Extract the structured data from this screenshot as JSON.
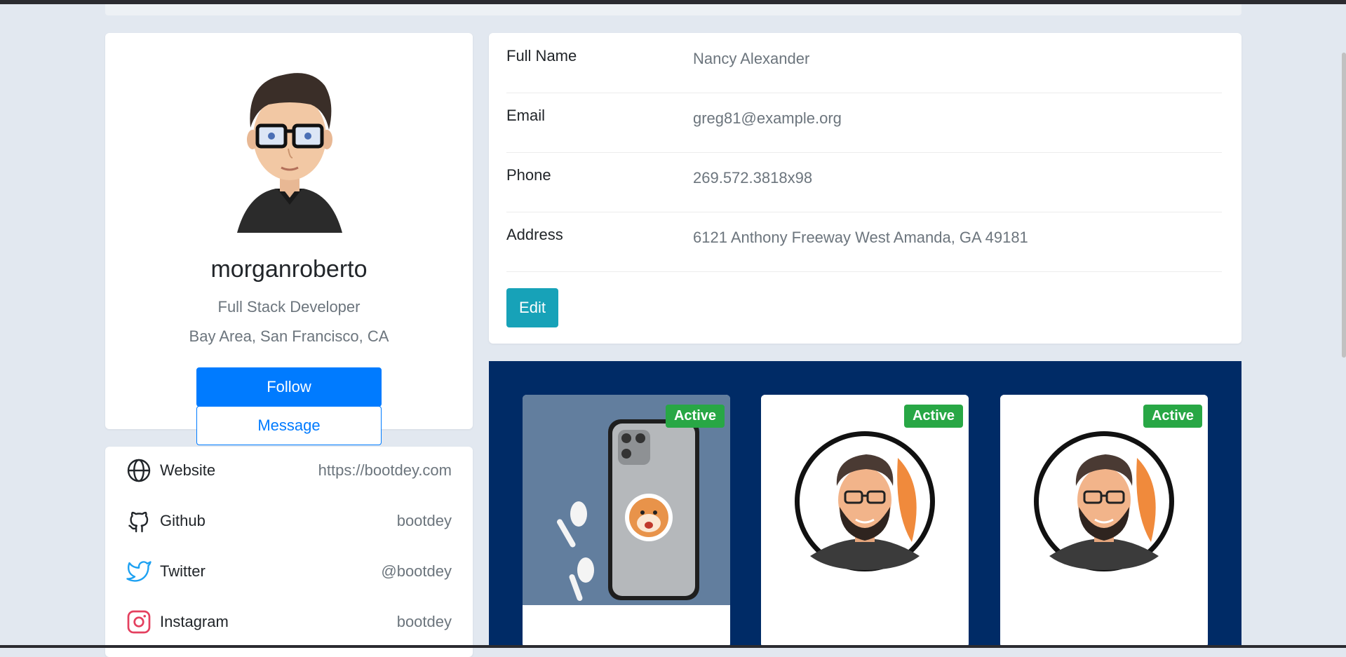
{
  "profile": {
    "username": "morganroberto",
    "role": "Full Stack Developer",
    "location": "Bay Area, San Francisco, CA",
    "follow_label": "Follow",
    "message_label": "Message"
  },
  "social": [
    {
      "icon": "globe-icon",
      "label": "Website",
      "value": "https://bootdey.com"
    },
    {
      "icon": "github-icon",
      "label": "Github",
      "value": "bootdey"
    },
    {
      "icon": "twitter-icon",
      "label": "Twitter",
      "value": "@bootdey"
    },
    {
      "icon": "instagram-icon",
      "label": "Instagram",
      "value": "bootdey"
    }
  ],
  "details": {
    "rows": [
      {
        "label": "Full Name",
        "value": "Nancy Alexander"
      },
      {
        "label": "Email",
        "value": "greg81@example.org"
      },
      {
        "label": "Phone",
        "value": "269.572.3818x98"
      },
      {
        "label": "Address",
        "value": "6121 Anthony Freeway West Amanda, GA 49181"
      }
    ],
    "edit_label": "Edit"
  },
  "gallery": [
    {
      "status": "Active"
    },
    {
      "status": "Active"
    },
    {
      "status": "Active"
    }
  ],
  "colors": {
    "primary": "#007bff",
    "info": "#17a2b8",
    "success": "#28a745",
    "gallery_bg": "#002b66",
    "page_bg": "#e2e8f0"
  }
}
